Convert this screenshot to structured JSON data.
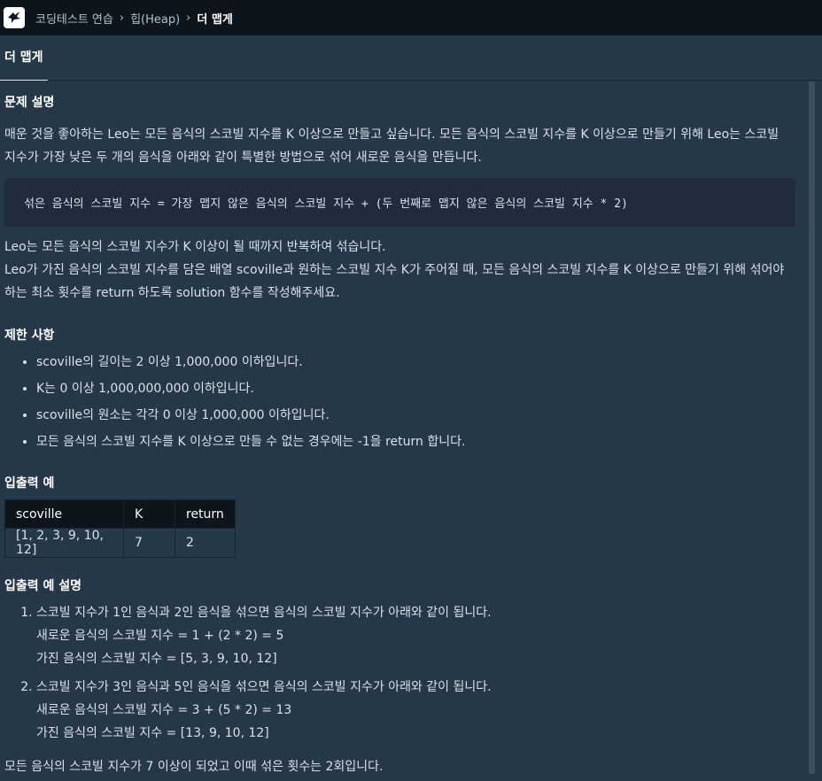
{
  "breadcrumb": [
    "코딩테스트 연습",
    "힙(Heap)",
    "더 맵게"
  ],
  "tab": "더 맵게",
  "sections": {
    "problem_title": "문제 설명",
    "problem_p1": "매운 것을 좋아하는 Leo는 모든 음식의 스코빌 지수를 K 이상으로 만들고 싶습니다. 모든 음식의 스코빌 지수를 K 이상으로 만들기 위해 Leo는 스코빌",
    "problem_p1b": "지수가 가장 낮은 두 개의 음식을 아래와 같이 특별한 방법으로 섞어 새로운 음식을 만듭니다.",
    "code": "섞은 음식의 스코빌 지수 = 가장 맵지 않은 음식의 스코빌 지수 + (두 번째로 맵지 않은 음식의 스코빌 지수 * 2)",
    "problem_p2": "Leo는 모든 음식의 스코빌 지수가 K 이상이 될 때까지 반복하여 섞습니다.",
    "problem_p3": "Leo가 가진 음식의 스코빌 지수를 담은 배열 scoville과 원하는 스코빌 지수 K가 주어질 때, 모든 음식의 스코빌 지수를 K 이상으로 만들기 위해 섞어야",
    "problem_p3b": "하는 최소 횟수를 return 하도록 solution 함수를 작성해주세요.",
    "limits_title": "제한 사항",
    "limits": [
      "scoville의 길이는 2 이상 1,000,000 이하입니다.",
      "K는 0 이상 1,000,000,000 이하입니다.",
      "scoville의 원소는 각각 0 이상 1,000,000 이하입니다.",
      "모든 음식의 스코빌 지수를 K 이상으로 만들 수 없는 경우에는 -1을 return 합니다."
    ],
    "io_title": "입출력 예",
    "io_headers": [
      "scoville",
      "K",
      "return"
    ],
    "io_row": [
      "[1, 2, 3, 9, 10, 12]",
      "7",
      "2"
    ],
    "ex_title": "입출력 예 설명",
    "ex": [
      {
        "main": "스코빌 지수가 1인 음식과 2인 음식을 섞으면 음식의 스코빌 지수가 아래와 같이 됩니다.",
        "l1": "새로운 음식의 스코빌 지수 = 1 + (2 * 2) = 5",
        "l2": "가진 음식의 스코빌 지수 = [5, 3, 9, 10, 12]"
      },
      {
        "main": "스코빌 지수가 3인 음식과 5인 음식을 섞으면 음식의 스코빌 지수가 아래와 같이 됩니다.",
        "l1": "새로운 음식의 스코빌 지수 = 3 + (5 * 2) = 13",
        "l2": "가진 음식의 스코빌 지수 = [13, 9, 10, 12]"
      }
    ],
    "conclusion": "모든 음식의 스코빌 지수가 7 이상이 되었고 이때 섞은 횟수는 2회입니다."
  }
}
